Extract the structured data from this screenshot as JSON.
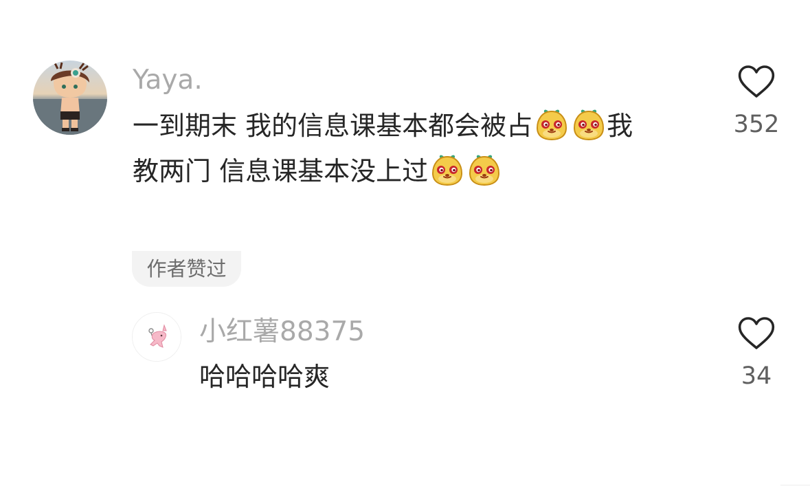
{
  "comments": [
    {
      "username": "Yaya.",
      "text_line1": "一到期末 我的信息课基本都会被占",
      "text_line1_tail": "我",
      "text_line2": "教两门 信息课基本没上过",
      "like_count": "352",
      "author_liked_label": "作者赞过"
    }
  ],
  "replies": [
    {
      "username": "小红薯88375",
      "text": "哈哈哈哈爽",
      "like_count": "34"
    }
  ],
  "icons": {
    "like": "heart-outline-icon",
    "emoji": "smirk-face-emoji-icon"
  },
  "colors": {
    "username": "#a9a9a9",
    "text": "#262626",
    "count": "#5f5f5f",
    "badge_bg": "#f3f3f3",
    "emoji_face": "#f3c948",
    "emoji_eye": "#c8262c"
  }
}
